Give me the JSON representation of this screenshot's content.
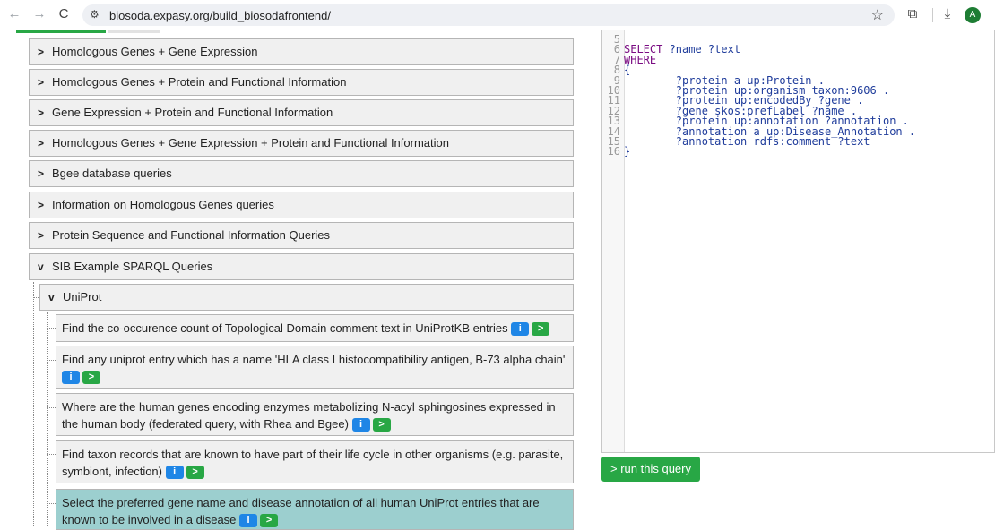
{
  "browser": {
    "url": "biosoda.expasy.org/build_biosodafrontend/",
    "avatar_letter": "A",
    "back_icon": "←",
    "forward_icon": "→",
    "reload_icon": "C",
    "site_settings_icon": "⚙",
    "star_icon": "☆",
    "extensions_icon": "⧉",
    "download_icon": "⤓"
  },
  "categories": [
    {
      "label": "Homologous Genes + Gene Expression",
      "chevron": ">"
    },
    {
      "label": "Homologous Genes + Protein and Functional Information",
      "chevron": ">"
    },
    {
      "label": "Gene Expression + Protein and Functional Information",
      "chevron": ">"
    },
    {
      "label": "Homologous Genes + Gene Expression + Protein and Functional Information",
      "chevron": ">"
    },
    {
      "label": "Bgee database queries",
      "chevron": ">"
    },
    {
      "label": "Information on Homologous Genes queries",
      "chevron": ">"
    },
    {
      "label": "Protein Sequence and Functional Information Queries",
      "chevron": ">"
    },
    {
      "label": "SIB Example SPARQL Queries",
      "chevron": "v"
    }
  ],
  "subcategory": {
    "label": "UniProt",
    "chevron": "v"
  },
  "queries": [
    {
      "text": "Find the co-occurence count of Topological Domain comment text in UniProtKB entries"
    },
    {
      "text": "Find any uniprot entry which has a name 'HLA class I histocompatibility antigen, B-73 alpha chain'"
    },
    {
      "text": "Where are the human genes encoding enzymes metabolizing N-acyl sphingosines expressed in the human body (federated query, with Rhea and Bgee)"
    },
    {
      "text": "Find taxon records that are known to have part of their life cycle in other organisms (e.g. parasite, symbiont, infection)"
    },
    {
      "text": "Select the preferred gene name and disease annotation of all human UniProt entries that are known to be involved in a disease"
    }
  ],
  "badges": {
    "info": "i",
    "run": ">"
  },
  "code": {
    "lines": [
      {
        "n": "5",
        "kw": "",
        "rest": ""
      },
      {
        "n": "6",
        "kw": "SELECT",
        "rest": " ?name ?text"
      },
      {
        "n": "7",
        "kw": "WHERE",
        "rest": ""
      },
      {
        "n": "8",
        "kw": "",
        "rest": "{"
      },
      {
        "n": "9",
        "kw": "",
        "rest": "        ?protein a up:Protein ."
      },
      {
        "n": "10",
        "kw": "",
        "rest": "        ?protein up:organism taxon:9606 ."
      },
      {
        "n": "11",
        "kw": "",
        "rest": "        ?protein up:encodedBy ?gene ."
      },
      {
        "n": "12",
        "kw": "",
        "rest": "        ?gene skos:prefLabel ?name ."
      },
      {
        "n": "13",
        "kw": "",
        "rest": "        ?protein up:annotation ?annotation ."
      },
      {
        "n": "14",
        "kw": "",
        "rest": "        ?annotation a up:Disease_Annotation ."
      },
      {
        "n": "15",
        "kw": "",
        "rest": "        ?annotation rdfs:comment ?text"
      },
      {
        "n": "16",
        "kw": "",
        "rest": "}"
      }
    ]
  },
  "run_button": "> run this query"
}
